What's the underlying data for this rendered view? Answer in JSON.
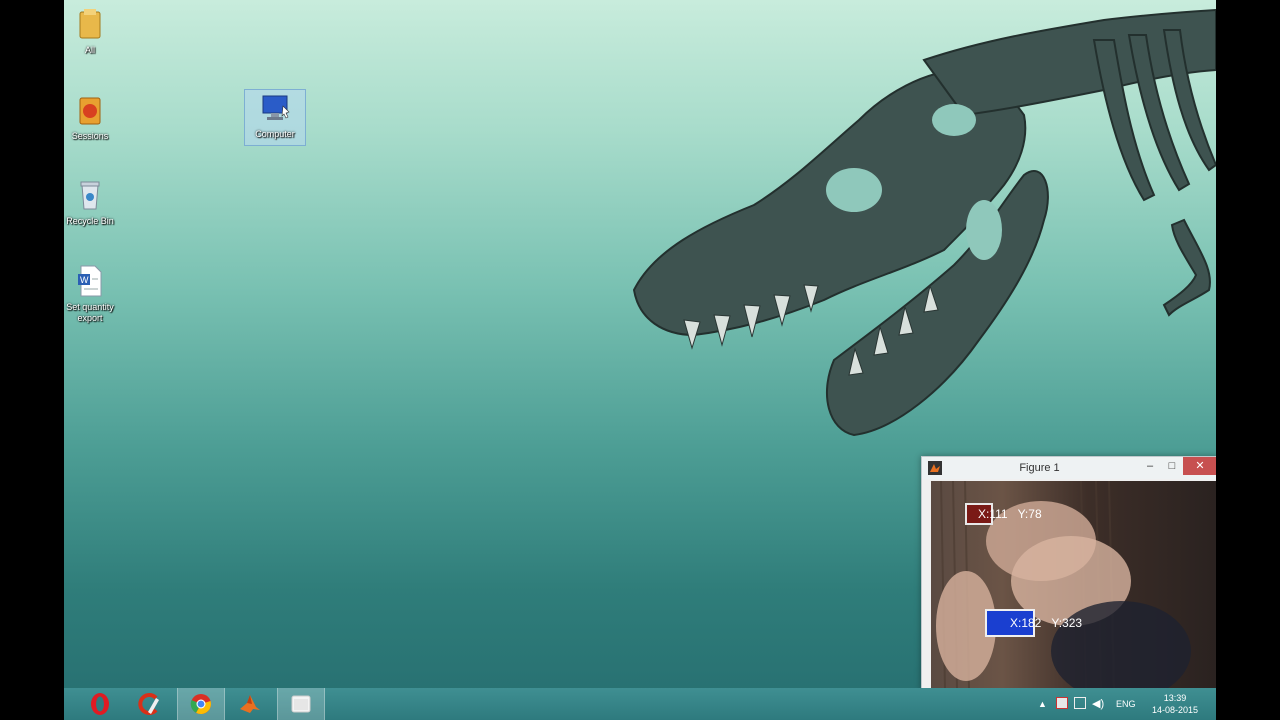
{
  "desktop": {
    "icons": [
      {
        "label": "All"
      },
      {
        "label": "Sessions"
      },
      {
        "label": "Computer"
      },
      {
        "label": "Recycle Bin"
      },
      {
        "label": "Set quantity",
        "label2": "export"
      }
    ]
  },
  "figure_window": {
    "title": "Figure 1",
    "controls": {
      "minimize": "–",
      "maximize": "□",
      "close": "✕"
    },
    "tracks": [
      {
        "x_label": "X:111",
        "y_label": "Y:78"
      },
      {
        "x_label": "X:182",
        "y_label": "Y:323"
      }
    ]
  },
  "taskbar": {
    "apps": [
      {
        "icon": "opera-icon"
      },
      {
        "icon": "ccleaner-icon"
      },
      {
        "icon": "chrome-icon"
      },
      {
        "icon": "matlab-icon"
      },
      {
        "icon": "camera-window-icon",
        "active": true
      }
    ],
    "tray": {
      "language": "ENG",
      "time": "13:39",
      "date": "14-08-2015"
    }
  },
  "colors": {
    "track1_box": "#7a1a16",
    "track2_box": "#1a3fd0",
    "close_button": "#c75050",
    "opera_red": "#e01b22"
  }
}
